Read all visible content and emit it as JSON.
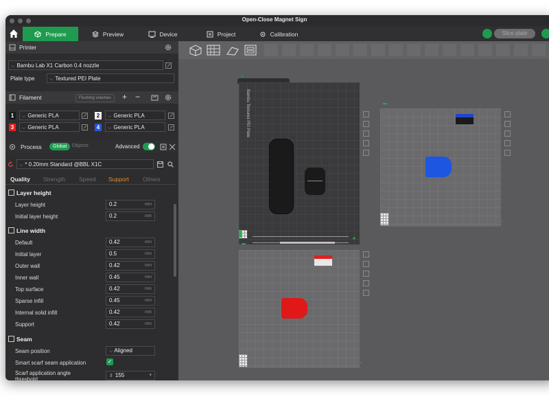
{
  "window": {
    "title": "Open-Close Magnet Sign"
  },
  "tabs": [
    {
      "label": "Prepare",
      "icon": "cube-icon"
    },
    {
      "label": "Preview",
      "icon": "layers-icon"
    },
    {
      "label": "Device",
      "icon": "device-icon"
    },
    {
      "label": "Project",
      "icon": "project-icon"
    },
    {
      "label": "Calibration",
      "icon": "calibration-icon"
    }
  ],
  "slice_button": "Slice plate",
  "printer": {
    "heading": "Printer",
    "model": "Bambu Lab X1 Carbon 0.4 nozzle",
    "plate_type_label": "Plate type",
    "plate_type": "Textured PEI Plate"
  },
  "filament": {
    "heading": "Filament",
    "flushing_label": "Flushing volumes",
    "slots": [
      {
        "num": "1",
        "name": "Generic PLA",
        "color": "#1a1a1a",
        "numcolor": "#ffffff"
      },
      {
        "num": "2",
        "name": "Generic PLA",
        "color": "#ffffff",
        "numcolor": "#000000"
      },
      {
        "num": "3",
        "name": "Generic PLA",
        "color": "#e02020",
        "numcolor": "#ffffff"
      },
      {
        "num": "4",
        "name": "Generic PLA",
        "color": "#2956d8",
        "numcolor": "#ffffff"
      }
    ]
  },
  "process": {
    "heading": "Process",
    "global_label": "Global",
    "objects_label": "Objects",
    "advanced_label": "Advanced",
    "preset": "* 0.20mm Standard @BBL X1C",
    "tabs": [
      "Quality",
      "Strength",
      "Speed",
      "Support",
      "Others"
    ]
  },
  "groups": {
    "layer_height": {
      "title": "Layer height",
      "rows": [
        {
          "label": "Layer height",
          "value": "0.2",
          "unit": "mm"
        },
        {
          "label": "Initial layer height",
          "value": "0.2",
          "unit": "mm"
        }
      ]
    },
    "line_width": {
      "title": "Line width",
      "rows": [
        {
          "label": "Default",
          "value": "0.42",
          "unit": "mm"
        },
        {
          "label": "Initial layer",
          "value": "0.5",
          "unit": "mm"
        },
        {
          "label": "Outer wall",
          "value": "0.42",
          "unit": "mm"
        },
        {
          "label": "Inner wall",
          "value": "0.45",
          "unit": "mm"
        },
        {
          "label": "Top surface",
          "value": "0.42",
          "unit": "mm"
        },
        {
          "label": "Sparse infill",
          "value": "0.45",
          "unit": "mm"
        },
        {
          "label": "Internal solid infill",
          "value": "0.42",
          "unit": "mm"
        },
        {
          "label": "Support",
          "value": "0.42",
          "unit": "mm"
        }
      ]
    },
    "seam": {
      "title": "Seam",
      "position_label": "Seam position",
      "position_value": "Aligned",
      "scarf_label": "Smart scarf seam application",
      "angle_label_1": "Scarf application angle",
      "angle_label_2": "threshold",
      "angle_value": "155"
    }
  },
  "plates": [
    {
      "bed_label": "Bambu Textured PEI Plate"
    }
  ],
  "colors": {
    "accent": "#1e9b4f",
    "panel": "#2d2d2f",
    "canvas": "#5a5a5c"
  }
}
